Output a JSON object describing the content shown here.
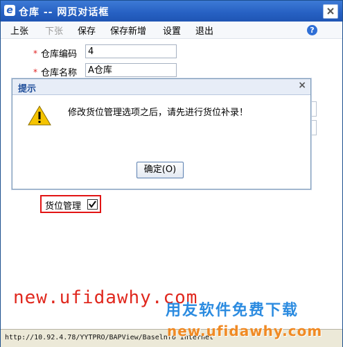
{
  "window": {
    "title": "仓库 -- 网页对话框"
  },
  "toolbar": {
    "items": [
      "上张",
      "下张",
      "保存",
      "保存新增",
      "设置",
      "退出"
    ],
    "help": "?"
  },
  "form": {
    "code_label": "仓库编码",
    "code_value": "4",
    "name_label": "仓库名称",
    "name_value": "A仓库",
    "required_mark": "*",
    "location_label": "货位管理",
    "location_checked": true
  },
  "dialog": {
    "title": "提示",
    "close": "×",
    "message": "修改货位管理选项之后，请先进行货位补录！",
    "ok_label": "确定(O)"
  },
  "status": {
    "url": "http://10.92.4.78/YYTPRO/BAPView/Baselnfo Internet"
  },
  "watermark": {
    "text1": "new.ufidawhy.com",
    "text2": "用友软件免费下载",
    "text3": "new.ufidawhy.com"
  }
}
